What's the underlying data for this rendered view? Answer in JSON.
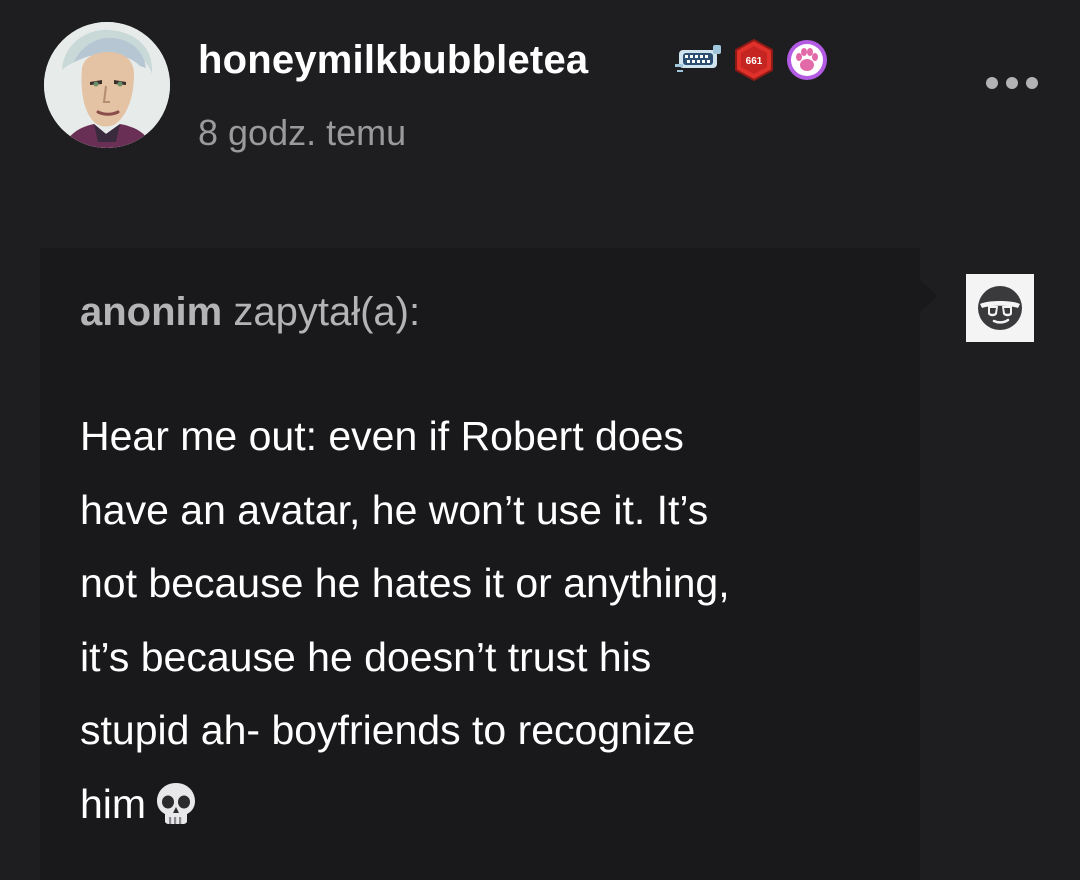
{
  "post": {
    "author": {
      "username": "honeymilkbubbletea",
      "avatar_icon": "illustrated-character-avatar",
      "badges": [
        {
          "icon": "zipper-mouth-badge-icon"
        },
        {
          "icon": "red-hexagon-badge-icon",
          "text": "661"
        },
        {
          "icon": "paw-print-badge-icon"
        }
      ]
    },
    "timestamp": "8 godz. temu",
    "more_icon": "more-options-icon"
  },
  "ask": {
    "asker_name": "anonim",
    "asker_verb": "zapytał(a):",
    "asker_avatar_icon": "anonymous-sunglasses-face-icon",
    "question_lines": [
      "Hear me out: even if Robert does",
      "have an avatar, he won’t use it. It’s",
      "not because he hates it or anything,",
      "it’s because he doesn’t trust his",
      "stupid ah- boyfriends to recognize",
      "him"
    ],
    "trailing_emoji_icon": "skull-emoji-icon"
  },
  "colors": {
    "background": "#1e1e20",
    "bubble": "#19191b",
    "text_primary": "#ffffff",
    "text_secondary": "#9a9a9d",
    "badge_red": "#e0302a",
    "badge_purple": "#b35be3"
  }
}
